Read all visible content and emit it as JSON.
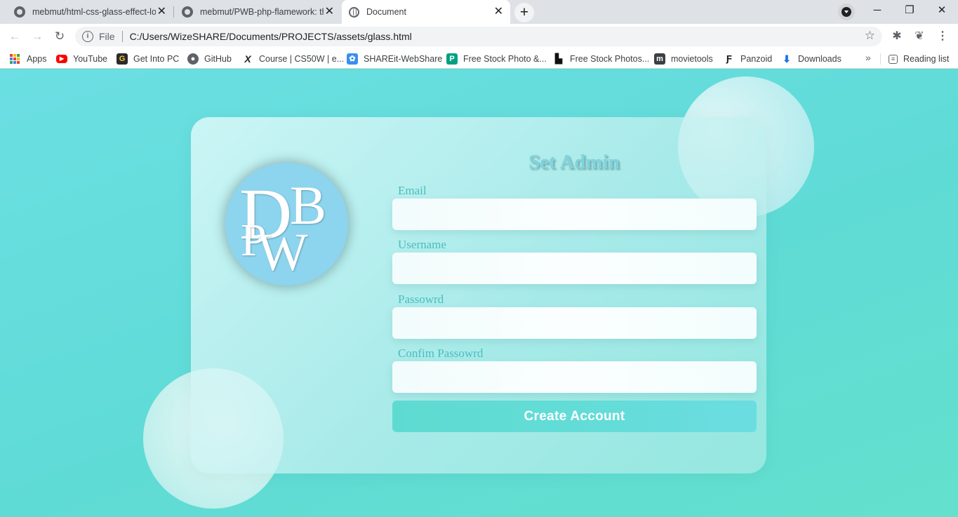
{
  "browser": {
    "tabs": [
      {
        "title": "mebmut/html-css-glass-effect-lo",
        "icon": "github-icon",
        "active": false
      },
      {
        "title": "mebmut/PWB-php-flamework: th",
        "icon": "github-icon",
        "active": false
      },
      {
        "title": "Document",
        "icon": "globe-icon",
        "active": true
      }
    ],
    "address": {
      "scheme_label": "File",
      "url": "C:/Users/WizeSHARE/Documents/PROJECTS/assets/glass.html"
    },
    "bookmarks": [
      {
        "label": "Apps",
        "icon": "apps-grid-icon"
      },
      {
        "label": "YouTube",
        "icon": "youtube-icon"
      },
      {
        "label": "Get Into PC",
        "icon": "getintopc-icon"
      },
      {
        "label": "GitHub",
        "icon": "github-icon"
      },
      {
        "label": "Course | CS50W | e...",
        "icon": "edx-icon"
      },
      {
        "label": "SHAREit-WebShare",
        "icon": "shareit-icon"
      },
      {
        "label": "Free Stock Photo &...",
        "icon": "pexels-icon"
      },
      {
        "label": "Free Stock Photos...",
        "icon": "unsplash-icon"
      },
      {
        "label": "movietools",
        "icon": "movietools-icon"
      },
      {
        "label": "Panzoid",
        "icon": "panzoid-icon"
      },
      {
        "label": "Downloads",
        "icon": "download-icon"
      }
    ],
    "reading_list": "Reading list"
  },
  "page": {
    "logo_letters": [
      "D",
      "B",
      "P",
      "W"
    ],
    "title": "Set Admin",
    "fields": [
      {
        "label": "Email",
        "value": ""
      },
      {
        "label": "Username",
        "value": ""
      },
      {
        "label": "Passowrd",
        "value": ""
      },
      {
        "label": "Confim Passowrd",
        "value": ""
      }
    ],
    "submit_label": "Create Account"
  },
  "colors": {
    "page_bg": "#5fdbd6",
    "label_color": "#4cbcbe",
    "title_color": "#7fd3dc",
    "button_color": "#62dbd6",
    "logo_disc": "#8dd4ef"
  }
}
